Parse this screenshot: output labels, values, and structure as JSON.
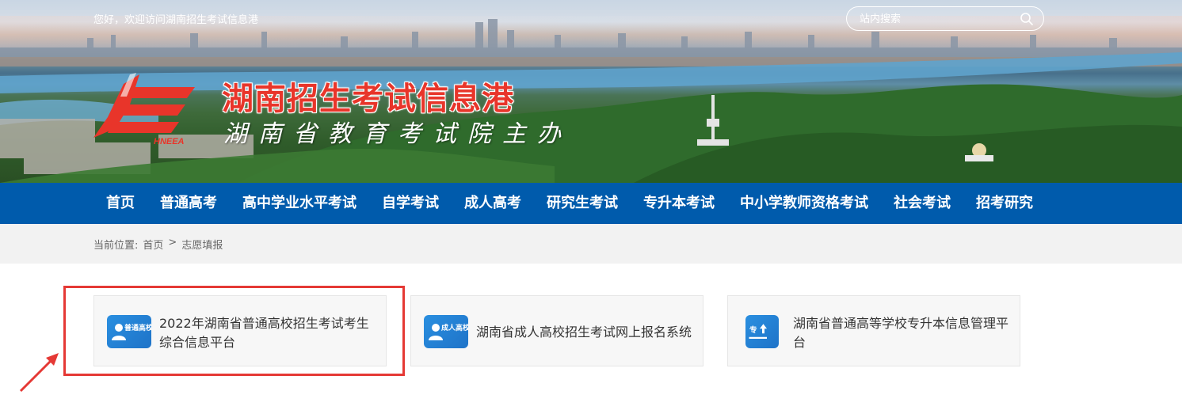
{
  "header": {
    "greeting": "您好，欢迎访问湖南招生考试信息港",
    "search_placeholder": "站内搜索",
    "site_title": "湖南招生考试信息港",
    "site_subtitle": "湖南省教育考试院主办",
    "logo_text": "HNEEA"
  },
  "nav": {
    "items": [
      "首页",
      "普通高考",
      "高中学业水平考试",
      "自学考试",
      "成人高考",
      "研究生考试",
      "专升本考试",
      "中小学教师资格考试",
      "社会考试",
      "招考研究"
    ]
  },
  "breadcrumb": {
    "label": "当前位置:",
    "home": "首页",
    "separator": ">",
    "current": "志愿填报"
  },
  "cards": [
    {
      "title": "2022年湖南省普通高校招生考试考生综合信息平台",
      "icon_text": "普通高校",
      "icon": "user-icon"
    },
    {
      "title": "湖南省成人高校招生考试网上报名系统",
      "icon_text": "成人高校",
      "icon": "user-icon"
    },
    {
      "title": "湖南省普通高等学校专升本信息管理平台",
      "icon_text": "专",
      "icon": "upgrade-icon"
    }
  ],
  "colors": {
    "nav_bg": "#005bac",
    "title_red": "#e8352a",
    "highlight_red": "#e53935",
    "card_icon_blue": "#1e73c8"
  }
}
